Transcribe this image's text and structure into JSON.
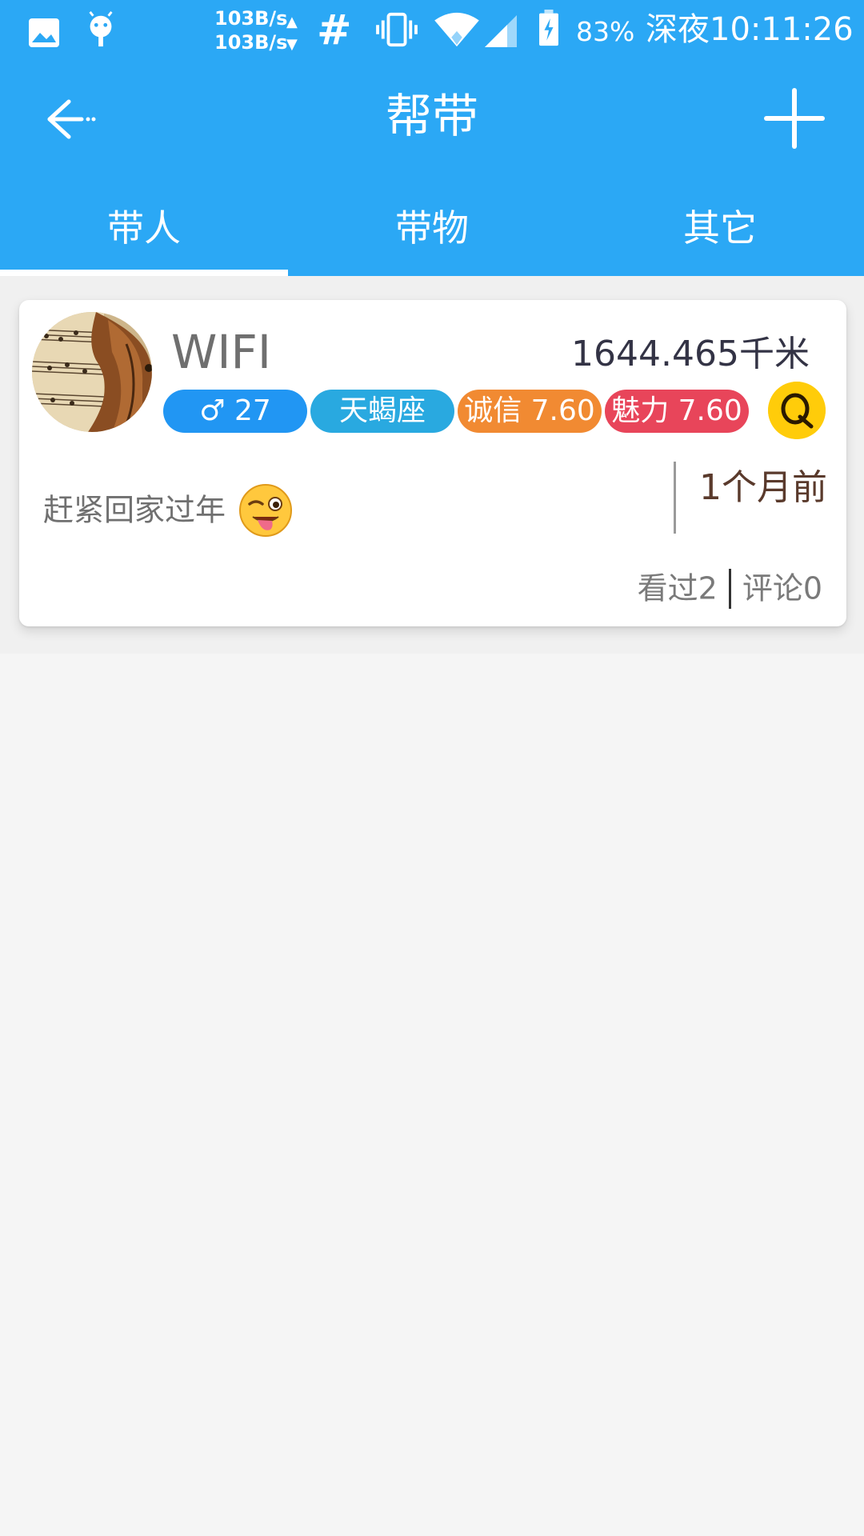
{
  "statusbar": {
    "net_up": "103B/s",
    "net_down": "103B/s",
    "hash": "#",
    "battery_percent": "83%",
    "time": "深夜10:11:26"
  },
  "appbar": {
    "title": "帮带"
  },
  "tabs": [
    {
      "label": "带人"
    },
    {
      "label": "带物"
    },
    {
      "label": "其它"
    }
  ],
  "card": {
    "name": "WIFI",
    "distance": "1644.465千米",
    "badges": {
      "gender_age": "♂ 27",
      "zodiac": "天蝎座",
      "credit": "诚信 7.60",
      "charm": "魅力 7.60"
    },
    "post_text": "赶紧回家过年",
    "time_ago": "1个月前",
    "views": "看过2",
    "comments": "评论0"
  },
  "colors": {
    "brand": "#2ba8f5",
    "badge_gender": "#2196f3",
    "badge_zodiac": "#29a9e0",
    "badge_credit": "#f18a32",
    "badge_charm": "#e8455a",
    "qq": "#ffcc0a"
  },
  "icons": [
    "image-icon",
    "android-icon",
    "vibrate-icon",
    "wifi-icon",
    "signal-icon",
    "battery-charging-icon",
    "back-arrow-icon",
    "plus-icon",
    "qq-icon",
    "wink-tongue-emoji"
  ]
}
